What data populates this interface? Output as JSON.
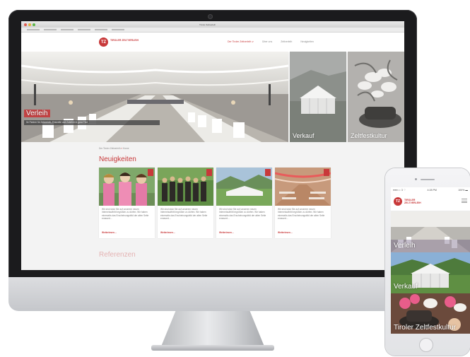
{
  "browser": {
    "title": "Tiroler Zeltverleih"
  },
  "site": {
    "logo_mark": "TZ",
    "logo_name": "TIROLER ZELTVERLEIH",
    "nav": [
      {
        "label": "Der Tiroler Zeltverleih ∨",
        "active": true
      },
      {
        "label": "Über uns",
        "active": false
      },
      {
        "label": "Zeltverleih",
        "active": false
      },
      {
        "label": "Neuigkeiten",
        "active": false
      }
    ],
    "hero": {
      "main_label": "Verleih",
      "caption": "Ihr Partner für Zeltverleih, Festzelte und Zubehör in ganz Tirol",
      "tent_label": "Verkauf",
      "fest_label": "Zeltfestkultur"
    },
    "breadcrumb": {
      "home": "Der Tiroler Zeltverleih",
      "sep": "»",
      "current": "Home"
    },
    "news_title": "Neuigkeiten",
    "news_cards": [
      {
        "text": "Wir sind stolz Sie auf unserem neuen Internetauftritt begrüßen zu dürfen. Wir haben einerseits das Erscheinungsbild der alten Seite erneuert…",
        "more": "Weiterlesen…"
      },
      {
        "text": "Wir sind stolz Sie auf unserem neuen Internetauftritt begrüßen zu dürfen. Wir haben einerseits das Erscheinungsbild der alten Seite erneuert…",
        "more": "Weiterlesen…"
      },
      {
        "text": "Wir sind stolz Sie auf unserem neuen Internetauftritt begrüßen zu dürfen. Wir haben einerseits das Erscheinungsbild der alten Seite erneuert…",
        "more": "Weiterlesen…"
      },
      {
        "text": "Wir sind stolz Sie auf unserem neuen Internetauftritt begrüßen zu dürfen. Wir haben einerseits das Erscheinungsbild der alten Seite erneuert…",
        "more": "Weiterlesen…"
      }
    ],
    "partners_title": "Referenzen"
  },
  "phone": {
    "status": {
      "carrier": "●●●○○ 3 ⌔",
      "time": "4:28 PM",
      "battery": "100% ▬"
    },
    "logo_mark": "TZ",
    "logo_name": "TIROLER ZELTVERLEIH",
    "tiles": [
      "Verleih",
      "Verkauf",
      "Tiroler Zeltfestkultur"
    ]
  },
  "colors": {
    "brand_red": "#c8393a",
    "imac_bezel": "#1b1b1d",
    "imac_chin": "#d0d2d5"
  },
  "icons": [
    "menu-icon",
    "home-button",
    "camera-icon"
  ]
}
